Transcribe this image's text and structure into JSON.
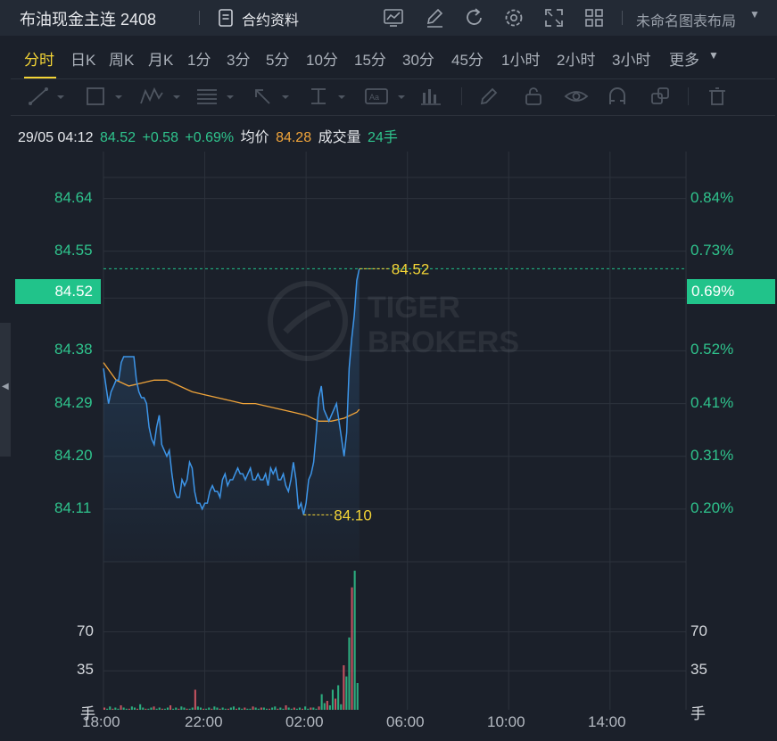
{
  "header": {
    "title": "布油现金主连 2408",
    "contract_label": "合约资料",
    "layout_name": "未命名图表布局",
    "icons": [
      "chart-template-icon",
      "draw-edit-icon",
      "refresh-icon",
      "settings-icon",
      "fullscreen-icon",
      "layout-grid-icon"
    ]
  },
  "periods": {
    "items": [
      "分时",
      "日K",
      "周K",
      "月K",
      "1分",
      "3分",
      "5分",
      "10分",
      "15分",
      "30分",
      "45分",
      "1小时",
      "2小时",
      "3小时",
      "更多"
    ],
    "active": "分时"
  },
  "info": {
    "datetime": "29/05 04:12",
    "price": "84.52",
    "change": "+0.58",
    "change_pct": "+0.69%",
    "avg_label": "均价",
    "avg_value": "84.28",
    "volume_label": "成交量",
    "volume_value": "24手"
  },
  "colors": {
    "up": "#2fc48d",
    "accent": "#f3d436",
    "avg_line": "#f0a43a",
    "price_line": "#3d95e8",
    "bg": "#1b202a"
  },
  "watermark": {
    "line1": "TIGER",
    "line2": "BROKERS"
  },
  "chart_data": {
    "type": "line",
    "x_ticks": [
      "18:00",
      "22:00",
      "02:00",
      "06:00",
      "10:00",
      "14:00"
    ],
    "price_axis": {
      "ticks": [
        "84.64",
        "84.55",
        "84.47",
        "84.38",
        "84.29",
        "84.20",
        "84.11"
      ],
      "ylim": [
        84.02,
        84.72
      ]
    },
    "pct_axis": {
      "ticks": [
        "0.84%",
        "0.73%",
        "0.63%",
        "0.52%",
        "0.41%",
        "0.31%",
        "0.20%"
      ]
    },
    "current_price_tag": "84.52",
    "current_pct_tag": "0.69%",
    "max_label": "84.52",
    "min_label": "84.10",
    "volume_axis": {
      "ticks": [
        "70",
        "35"
      ],
      "unit": "手",
      "ylim": [
        0,
        125
      ]
    },
    "series": [
      {
        "name": "price",
        "x": [
          0,
          0.1,
          0.2,
          0.3,
          0.4,
          0.5,
          0.6,
          0.7,
          0.8,
          0.9,
          1.0,
          1.1,
          1.2,
          1.3,
          1.4,
          1.5,
          1.6,
          1.7,
          1.8,
          1.9,
          2.0,
          2.1,
          2.2,
          2.3,
          2.4,
          2.5,
          2.6,
          2.7,
          2.8,
          2.9,
          3.0,
          3.1,
          3.2,
          3.3,
          3.4,
          3.5,
          3.6,
          3.7,
          3.8,
          3.9,
          4.0,
          4.1,
          4.2,
          4.3,
          4.4,
          4.5,
          4.6,
          4.7,
          4.8,
          4.9,
          5.0,
          5.1,
          5.2,
          5.3,
          5.4,
          5.5,
          5.6,
          5.7,
          5.8,
          5.9,
          6.0,
          6.1,
          6.2,
          6.3,
          6.4,
          6.5,
          6.6,
          6.7,
          6.8,
          6.9,
          7.0,
          7.1,
          7.2,
          7.3,
          7.4,
          7.5,
          7.6,
          7.7,
          7.8,
          7.9,
          8.0,
          8.1,
          8.2,
          8.3,
          8.4,
          8.5,
          8.6,
          8.7,
          8.8,
          8.9,
          9.0,
          9.1,
          9.2,
          9.3,
          9.4,
          9.5,
          9.6,
          9.7,
          9.8,
          9.9,
          10.0,
          10.1
        ],
        "values": [
          84.35,
          84.32,
          84.29,
          84.31,
          84.32,
          84.33,
          84.33,
          84.36,
          84.37,
          84.37,
          84.37,
          84.37,
          84.37,
          84.33,
          84.31,
          84.3,
          84.3,
          84.29,
          84.25,
          84.23,
          84.22,
          84.25,
          84.27,
          84.22,
          84.21,
          84.2,
          84.21,
          84.17,
          84.14,
          84.13,
          84.13,
          84.16,
          84.15,
          84.16,
          84.19,
          84.18,
          84.14,
          84.12,
          84.12,
          84.11,
          84.12,
          84.12,
          84.14,
          84.15,
          84.14,
          84.14,
          84.13,
          84.16,
          84.17,
          84.15,
          84.16,
          84.16,
          84.17,
          84.18,
          84.17,
          84.17,
          84.16,
          84.17,
          84.18,
          84.16,
          84.16,
          84.17,
          84.16,
          84.16,
          84.17,
          84.15,
          84.18,
          84.17,
          84.18,
          84.16,
          84.16,
          84.17,
          84.15,
          84.14,
          84.16,
          84.19,
          84.16,
          84.11,
          84.12,
          84.1,
          84.12,
          84.16,
          84.17,
          84.19,
          84.24,
          84.3,
          84.32,
          84.28,
          84.27,
          84.26,
          84.27,
          84.28,
          84.29,
          84.26,
          84.23,
          84.2,
          84.24,
          84.35,
          84.4,
          84.44,
          84.5,
          84.52
        ],
        "area": "gradient"
      },
      {
        "name": "average",
        "x": [
          0,
          0.5,
          1.0,
          1.5,
          2.0,
          2.5,
          3.0,
          3.5,
          4.0,
          4.5,
          5.0,
          5.5,
          6.0,
          6.5,
          7.0,
          7.5,
          8.0,
          8.5,
          9.0,
          9.5,
          10.0,
          10.1
        ],
        "values": [
          84.36,
          84.33,
          84.32,
          84.325,
          84.33,
          84.33,
          84.32,
          84.31,
          84.305,
          84.3,
          84.295,
          84.29,
          84.29,
          84.285,
          84.28,
          84.275,
          84.27,
          84.26,
          84.26,
          84.265,
          84.275,
          84.28
        ]
      }
    ],
    "volume_bars": [
      2,
      1,
      3,
      1,
      2,
      1,
      4,
      2,
      1,
      1,
      3,
      2,
      1,
      5,
      2,
      1,
      1,
      2,
      3,
      1,
      2,
      1,
      1,
      2,
      4,
      1,
      2,
      1,
      3,
      2,
      1,
      1,
      2,
      18,
      3,
      2,
      1,
      1,
      2,
      1,
      3,
      2,
      1,
      2,
      1,
      1,
      2,
      3,
      1,
      2,
      1,
      2,
      1,
      1,
      3,
      2,
      1,
      2,
      2,
      1,
      1,
      2,
      3,
      1,
      2,
      1,
      4,
      2,
      1,
      2,
      1,
      2,
      1,
      3,
      1,
      2,
      2,
      1,
      3,
      14,
      6,
      8,
      4,
      18,
      10,
      22,
      5,
      40,
      30,
      65,
      110,
      125,
      24
    ]
  }
}
